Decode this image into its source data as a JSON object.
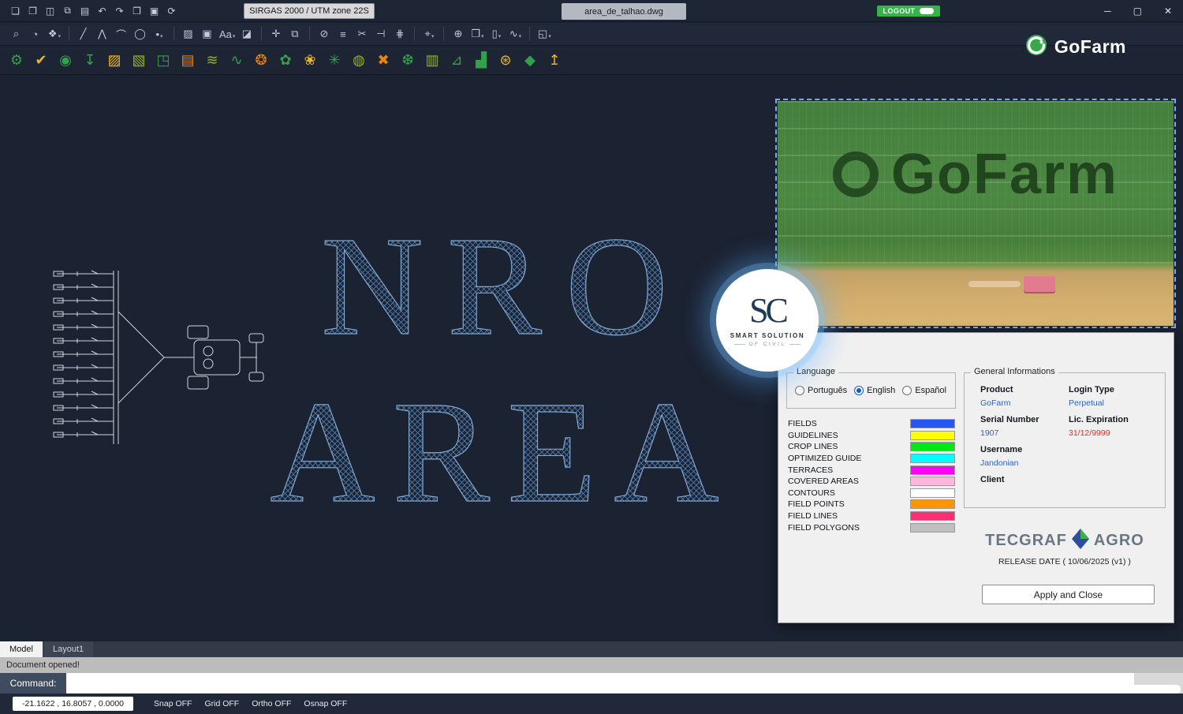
{
  "header": {
    "crs_label": "SIRGAS 2000 / UTM zone 22S",
    "document_name": "area_de_talhao.dwg",
    "logout_label": "LOGOUT",
    "brand_name": "GoFarm",
    "window_controls": {
      "minimize": "─",
      "maximize": "▢",
      "close": "✕"
    }
  },
  "toolbars": {
    "file_icons": [
      {
        "glyph": "❏",
        "name": "new-file-icon"
      },
      {
        "glyph": "❐",
        "name": "open-file-icon"
      },
      {
        "glyph": "◫",
        "name": "save-icon"
      },
      {
        "glyph": "⧉",
        "name": "save-all-icon"
      },
      {
        "glyph": "▤",
        "name": "print-icon"
      },
      {
        "glyph": "↶",
        "name": "undo-icon"
      },
      {
        "glyph": "↷",
        "name": "redo-icon"
      },
      {
        "glyph": "❒",
        "name": "copy-icon"
      },
      {
        "glyph": "▣",
        "name": "paste-icon"
      },
      {
        "glyph": "⟳",
        "name": "refresh-icon"
      }
    ],
    "edit_icons": [
      {
        "glyph": "⌕",
        "name": "zoom-icon"
      },
      {
        "glyph": "◔",
        "name": "orbit-icon"
      },
      {
        "glyph": "❖",
        "name": "layers-icon",
        "dd": true
      },
      {
        "divider": true,
        "name": "toolbar-divider"
      },
      {
        "glyph": "╱",
        "name": "line-tool-icon"
      },
      {
        "glyph": "⋀",
        "name": "polyline-tool-icon"
      },
      {
        "glyph": "⌒",
        "name": "arc-tool-icon"
      },
      {
        "glyph": "◯",
        "name": "circle-tool-icon"
      },
      {
        "glyph": "•",
        "name": "point-tool-icon",
        "dd": true
      },
      {
        "divider": true,
        "name": "toolbar-divider"
      },
      {
        "glyph": "▨",
        "name": "hatch-tool-icon"
      },
      {
        "glyph": "▣",
        "name": "region-tool-icon"
      },
      {
        "glyph": "Aa",
        "name": "text-tool-icon",
        "dd": true
      },
      {
        "glyph": "◪",
        "name": "image-tool-icon"
      },
      {
        "divider": true,
        "name": "toolbar-divider"
      },
      {
        "glyph": "✛",
        "name": "move-tool-icon"
      },
      {
        "glyph": "⧉",
        "name": "copy-tool-icon"
      },
      {
        "divider": true,
        "name": "toolbar-divider"
      },
      {
        "glyph": "⊘",
        "name": "erase-tool-icon"
      },
      {
        "glyph": "≡",
        "name": "properties-icon"
      },
      {
        "glyph": "✂",
        "name": "trim-tool-icon"
      },
      {
        "glyph": "⊣",
        "name": "extend-tool-icon"
      },
      {
        "glyph": "⋕",
        "name": "snap-settings-icon"
      },
      {
        "divider": true,
        "name": "toolbar-divider"
      },
      {
        "glyph": "⌖",
        "name": "select-tool-icon",
        "dd": true
      },
      {
        "divider": true,
        "name": "toolbar-divider"
      },
      {
        "glyph": "⊕",
        "name": "insert-block-icon"
      },
      {
        "glyph": "❒",
        "name": "block-tool-icon",
        "dd": true
      },
      {
        "glyph": "▯",
        "name": "clipboard-tool-icon",
        "dd": true
      },
      {
        "glyph": "∿",
        "name": "measure-tool-icon",
        "dd": true
      },
      {
        "divider": true,
        "name": "toolbar-divider"
      },
      {
        "glyph": "◱",
        "name": "viewport-tool-icon",
        "dd": true
      }
    ],
    "gofarm_icons": [
      {
        "glyph": "⚙",
        "color": "#33a04a",
        "name": "gofarm-settings-icon"
      },
      {
        "glyph": "✔",
        "color": "#eeb320",
        "name": "gofarm-check-icon"
      },
      {
        "glyph": "◉",
        "color": "#33a04a",
        "name": "gofarm-pin-icon"
      },
      {
        "glyph": "↧",
        "color": "#33a04a",
        "name": "gofarm-download-icon"
      },
      {
        "glyph": "▨",
        "color": "#eeb320",
        "name": "gofarm-field-hatch-icon"
      },
      {
        "glyph": "▧",
        "color": "#93b41c",
        "name": "gofarm-guideline-icon"
      },
      {
        "glyph": "◳",
        "color": "#33a04a",
        "name": "gofarm-plot-icon"
      },
      {
        "glyph": "▤",
        "color": "#e8870f",
        "name": "gofarm-rows-icon"
      },
      {
        "glyph": "≋",
        "color": "#93b41c",
        "name": "gofarm-terrace-icon"
      },
      {
        "glyph": "∿",
        "color": "#33a04a",
        "name": "gofarm-contour-icon"
      },
      {
        "glyph": "❂",
        "color": "#e8870f",
        "name": "gofarm-optimized-icon"
      },
      {
        "glyph": "✿",
        "color": "#33a04a",
        "name": "gofarm-crop-icon"
      },
      {
        "glyph": "❀",
        "color": "#eeb320",
        "name": "gofarm-plant-icon"
      },
      {
        "glyph": "✳",
        "color": "#33a04a",
        "name": "gofarm-spray-icon"
      },
      {
        "glyph": "◍",
        "color": "#93b41c",
        "name": "gofarm-coverage-icon"
      },
      {
        "glyph": "✖",
        "color": "#e8870f",
        "name": "gofarm-remove-icon"
      },
      {
        "glyph": "❆",
        "color": "#33a04a",
        "name": "gofarm-pattern-icon"
      },
      {
        "glyph": "▥",
        "color": "#93b41c",
        "name": "gofarm-lines-icon"
      },
      {
        "glyph": "⊿",
        "color": "#33a04a",
        "name": "gofarm-slope-icon"
      },
      {
        "glyph": "▟",
        "color": "#33a04a",
        "name": "gofarm-chart-icon"
      },
      {
        "glyph": "⊛",
        "color": "#eeb320",
        "name": "gofarm-globe-icon"
      },
      {
        "glyph": "◆",
        "color": "#33a04a",
        "name": "gofarm-tag-icon"
      },
      {
        "glyph": "↥",
        "color": "#eeb320",
        "name": "gofarm-upload-icon"
      }
    ]
  },
  "canvas": {
    "hatch_line1": "NRO",
    "hatch_line2": "AREA",
    "aerial_logo_text": "GoFarm"
  },
  "watermark": {
    "monogram": "SC",
    "title": "SMART SOLUTION",
    "subtitle": "OF CIVIL"
  },
  "dialog": {
    "language": {
      "title": "Language",
      "options": [
        {
          "label": "Português",
          "name": "radio-portugues"
        },
        {
          "label": "English",
          "selected": true,
          "name": "radio-english"
        },
        {
          "label": "Español",
          "name": "radio-espanol"
        }
      ]
    },
    "layers": [
      {
        "label": "FIELDS",
        "color": "#2457f5"
      },
      {
        "label": "GUIDELINES",
        "color": "#ffff00"
      },
      {
        "label": "CROP LINES",
        "color": "#00e817"
      },
      {
        "label": "OPTIMIZED GUIDE",
        "color": "#00ffff"
      },
      {
        "label": "TERRACES",
        "color": "#ff00ff"
      },
      {
        "label": "COVERED AREAS",
        "color": "#ffb6de"
      },
      {
        "label": "CONTOURS",
        "color": "#ffffff"
      },
      {
        "label": "FIELD POINTS",
        "color": "#ff9500"
      },
      {
        "label": "FIELD LINES",
        "color": "#ff2e75"
      },
      {
        "label": "FIELD POLYGONS",
        "color": "#bfbfbf"
      }
    ],
    "general": {
      "title": "General Informations",
      "product_label": "Product",
      "product_value": "GoFarm",
      "login_type_label": "Login Type",
      "login_type_value": "Perpetual",
      "serial_label": "Serial Number",
      "serial_value": "1907",
      "lic_label": "Lic. Expiration",
      "lic_value": "31/12/9999",
      "username_label": "Username",
      "username_value": "Jandonian",
      "client_label": "Client"
    },
    "tecgraf_text": "TECGRAF",
    "agro_text": "AGRO",
    "release_text": "RELEASE DATE ( 10/06/2025 (v1) )",
    "apply_label": "Apply and Close"
  },
  "footer": {
    "tabs": [
      {
        "label": "Model",
        "active": true,
        "name": "tab-model"
      },
      {
        "label": "Layout1",
        "name": "tab-layout1"
      }
    ],
    "status_message": "Document opened!",
    "command_label": "Command:",
    "coords": "-21.1622 , 16.8057 , 0.0000",
    "status_flags": [
      "Snap OFF",
      "Grid OFF",
      "Ortho OFF",
      "Osnap OFF"
    ]
  },
  "colors": {
    "accent_green": "#35b44a",
    "hatch_blue": "#517fb0",
    "selection_blue": "#78a9ee"
  }
}
